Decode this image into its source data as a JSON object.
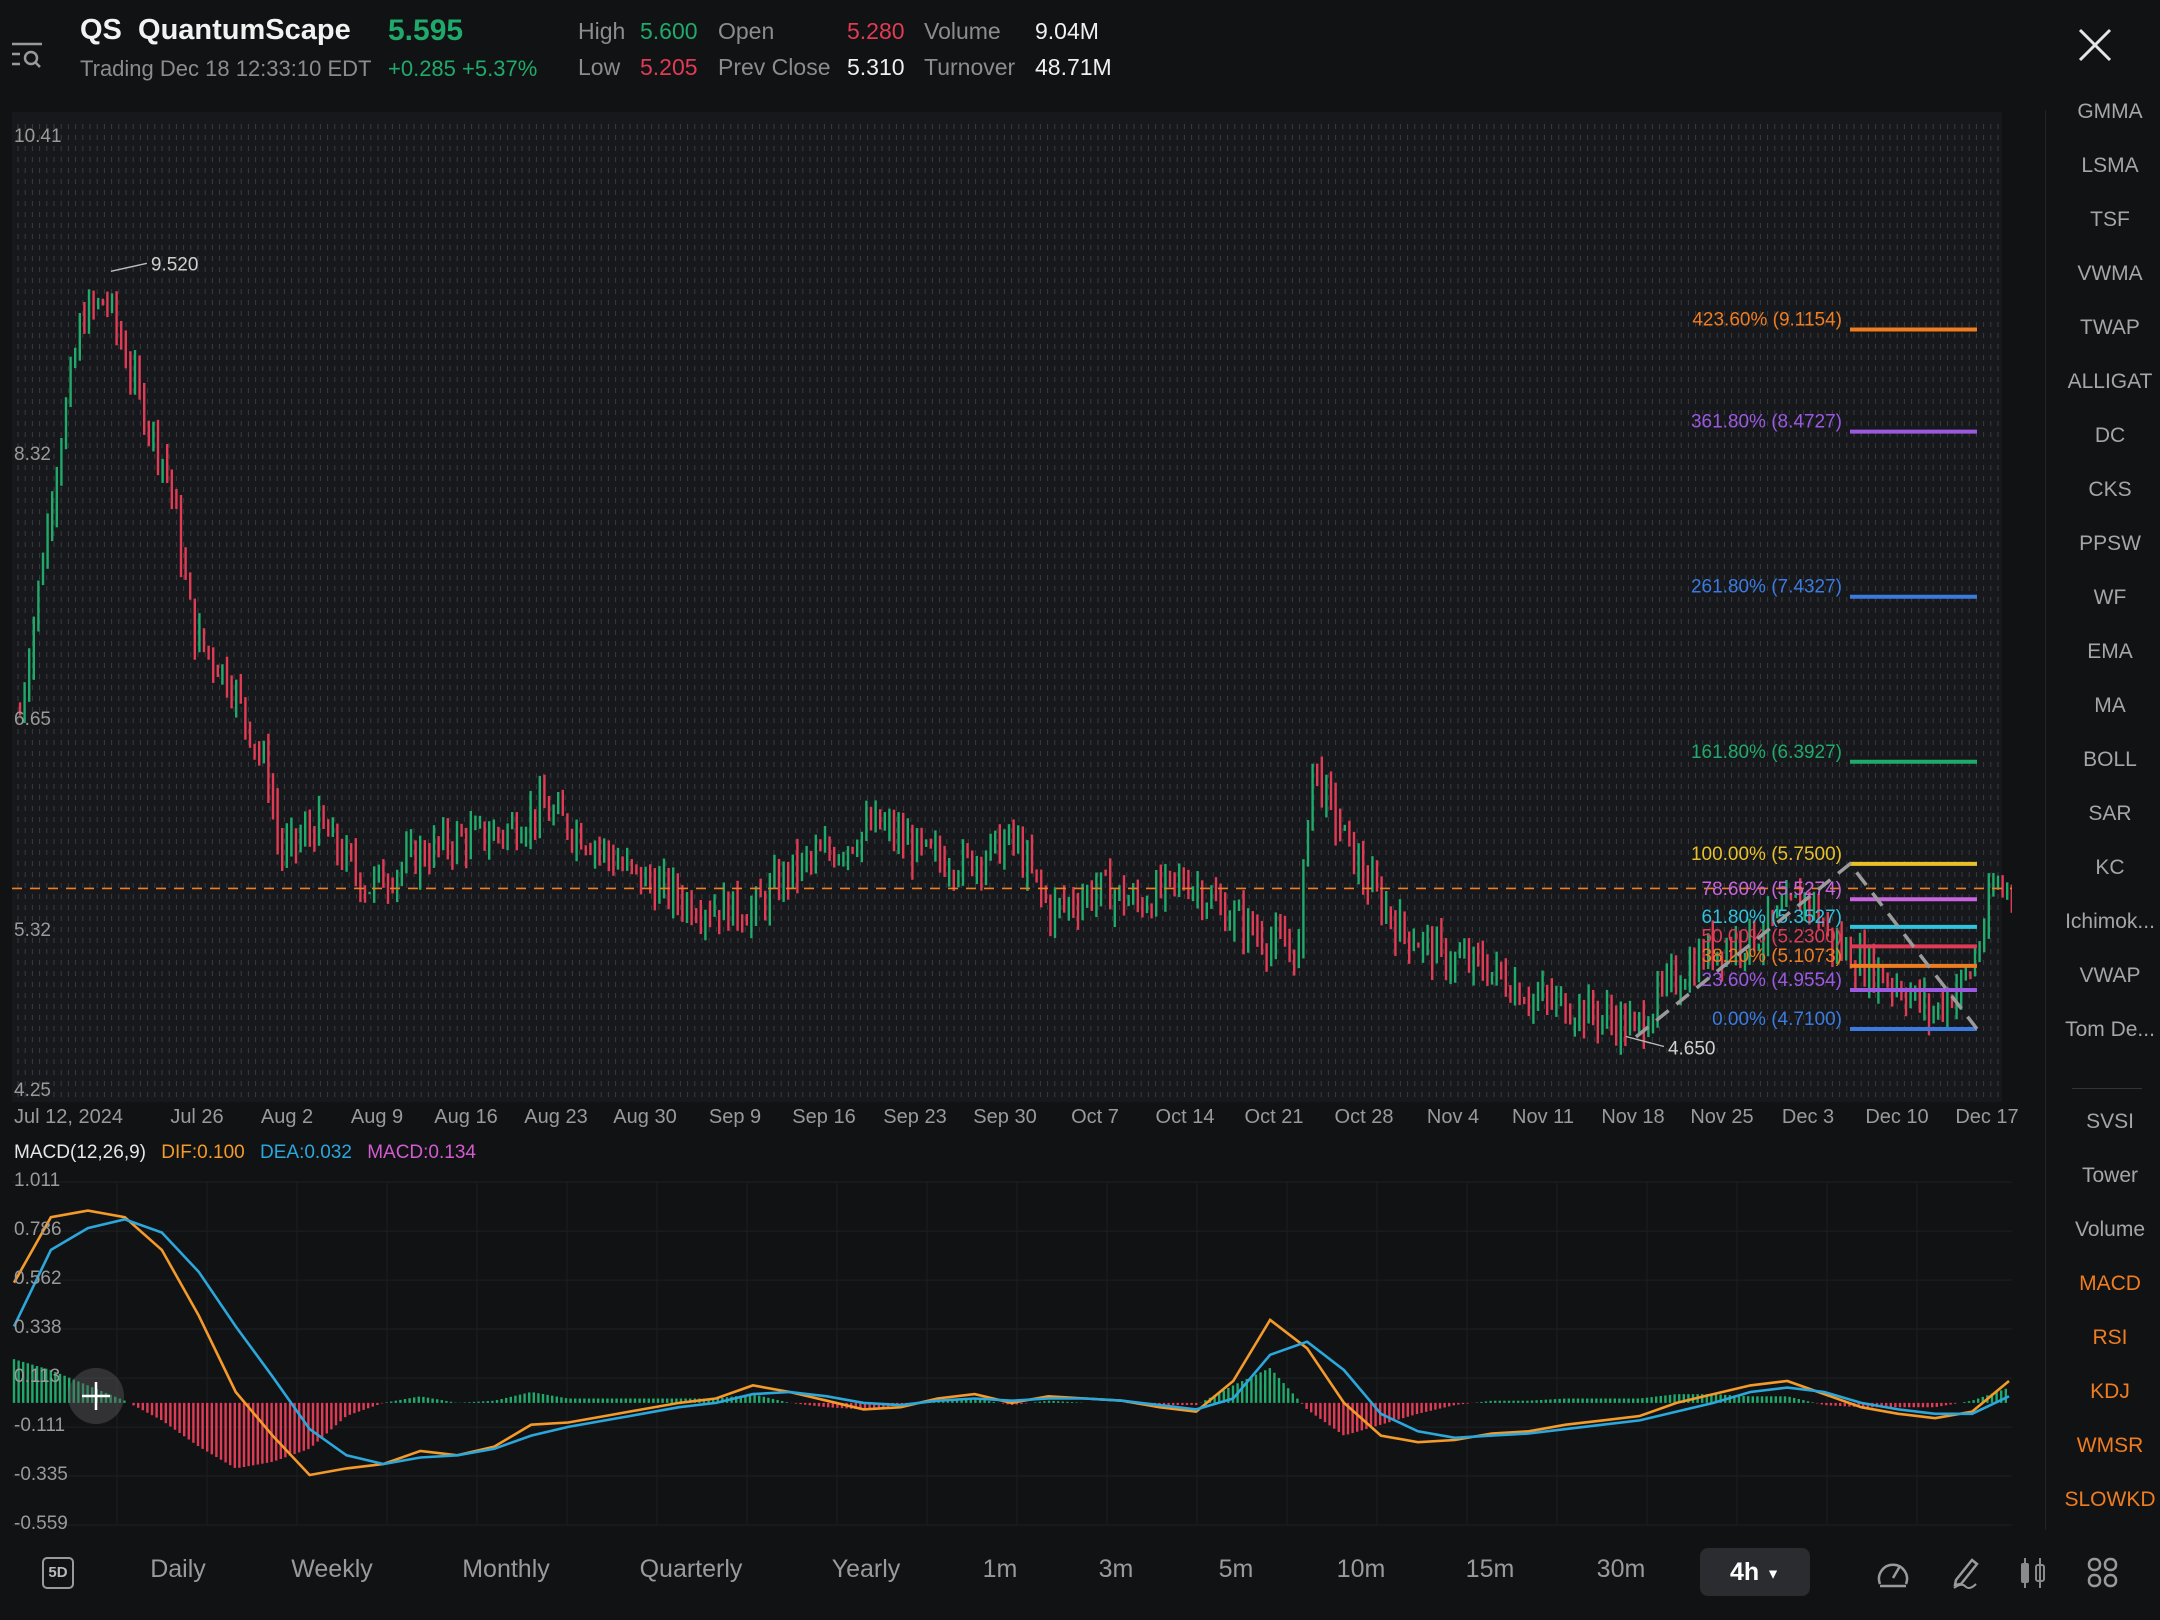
{
  "header": {
    "symbol": "QS",
    "name": "QuantumScape",
    "price": "5.595",
    "status": "Trading Dec 18 12:33:10 EDT",
    "change": "+0.285",
    "change_pct": "+5.37%",
    "stats": {
      "high_label": "High",
      "high": "5.600",
      "low_label": "Low",
      "low": "5.205",
      "open_label": "Open",
      "open": "5.280",
      "prev_close_label": "Prev Close",
      "prev_close": "5.310",
      "volume_label": "Volume",
      "volume": "9.04M",
      "turnover_label": "Turnover",
      "turnover": "48.71M"
    }
  },
  "colors": {
    "up": "#1faa6b",
    "down": "#e03b55",
    "accent": "#ee7d22",
    "dif": "#f39a2a",
    "dea": "#2ba7db",
    "macd": "#d35bd0"
  },
  "indicators": {
    "main": [
      "GMMA",
      "LSMA",
      "TSF",
      "VWMA",
      "TWAP",
      "ALLIGAT",
      "DC",
      "CKS",
      "PPSW",
      "WF",
      "EMA",
      "MA",
      "BOLL",
      "SAR",
      "KC",
      "Ichimok...",
      "VWAP",
      "Tom De..."
    ],
    "sub": [
      {
        "label": "SVSI",
        "active": false
      },
      {
        "label": "Tower",
        "active": false
      },
      {
        "label": "Volume",
        "active": false
      },
      {
        "label": "MACD",
        "active": true
      },
      {
        "label": "RSI",
        "active": true
      },
      {
        "label": "KDJ",
        "active": true
      },
      {
        "label": "WMSR",
        "active": true
      },
      {
        "label": "SLOWKD",
        "active": true
      }
    ]
  },
  "toolbar": {
    "five_day": "5D",
    "periods": [
      "Daily",
      "Weekly",
      "Monthly",
      "Quarterly",
      "Yearly",
      "1m",
      "3m",
      "5m",
      "10m",
      "15m",
      "30m"
    ],
    "active_period": "4h",
    "icons": [
      "speedometer-icon",
      "pencil-draw-icon",
      "candlestick-icon",
      "grid-menu-icon"
    ]
  },
  "chart_data": [
    {
      "type": "candlestick",
      "title": "QS QuantumScape 4h",
      "y_ticks": [
        "10.41",
        "8.32",
        "6.65",
        "5.32",
        "4.25"
      ],
      "ylim": [
        4.25,
        10.41
      ],
      "x_ticks": [
        "Jul 12, 2024",
        "Jul 26",
        "Aug 2",
        "Aug 9",
        "Aug 16",
        "Aug 23",
        "Aug 30",
        "Sep 9",
        "Sep 16",
        "Sep 23",
        "Sep 30",
        "Oct 7",
        "Oct 14",
        "Oct 21",
        "Oct 28",
        "Nov 4",
        "Nov 11",
        "Nov 18",
        "Nov 25",
        "Dec 3",
        "Dec 10",
        "Dec 17"
      ],
      "current_price_line": 5.595,
      "annotations": [
        {
          "label": "9.520",
          "type": "high",
          "date": "Jul 19"
        },
        {
          "label": "4.650",
          "type": "low",
          "date": "Nov 19"
        }
      ],
      "price_path": [
        {
          "x": "Jul 12",
          "v": 6.7
        },
        {
          "x": "Jul 15",
          "v": 8.3
        },
        {
          "x": "Jul 17",
          "v": 9.2
        },
        {
          "x": "Jul 19",
          "v": 9.3
        },
        {
          "x": "Jul 22",
          "v": 8.6
        },
        {
          "x": "Jul 24",
          "v": 8.2
        },
        {
          "x": "Jul 26",
          "v": 7.2
        },
        {
          "x": "Jul 29",
          "v": 6.9
        },
        {
          "x": "Aug 1",
          "v": 6.3
        },
        {
          "x": "Aug 2",
          "v": 5.8
        },
        {
          "x": "Aug 5",
          "v": 6.0
        },
        {
          "x": "Aug 7",
          "v": 5.8
        },
        {
          "x": "Aug 9",
          "v": 5.6
        },
        {
          "x": "Aug 13",
          "v": 5.8
        },
        {
          "x": "Aug 16",
          "v": 5.9
        },
        {
          "x": "Aug 20",
          "v": 5.95
        },
        {
          "x": "Aug 23",
          "v": 6.1
        },
        {
          "x": "Aug 27",
          "v": 5.9
        },
        {
          "x": "Aug 30",
          "v": 5.7
        },
        {
          "x": "Sep 4",
          "v": 5.5
        },
        {
          "x": "Sep 9",
          "v": 5.45
        },
        {
          "x": "Sep 12",
          "v": 5.7
        },
        {
          "x": "Sep 16",
          "v": 5.85
        },
        {
          "x": "Sep 19",
          "v": 6.0
        },
        {
          "x": "Sep 23",
          "v": 5.8
        },
        {
          "x": "Sep 26",
          "v": 5.75
        },
        {
          "x": "Sep 30",
          "v": 5.9
        },
        {
          "x": "Oct 3",
          "v": 5.45
        },
        {
          "x": "Oct 7",
          "v": 5.6
        },
        {
          "x": "Oct 10",
          "v": 5.5
        },
        {
          "x": "Oct 14",
          "v": 5.65
        },
        {
          "x": "Oct 17",
          "v": 5.45
        },
        {
          "x": "Oct 21",
          "v": 5.25
        },
        {
          "x": "Oct 23",
          "v": 5.2
        },
        {
          "x": "Oct 24",
          "v": 6.4
        },
        {
          "x": "Oct 25",
          "v": 6.2
        },
        {
          "x": "Oct 28",
          "v": 5.7
        },
        {
          "x": "Oct 31",
          "v": 5.35
        },
        {
          "x": "Nov 4",
          "v": 5.15
        },
        {
          "x": "Nov 7",
          "v": 5.1
        },
        {
          "x": "Nov 11",
          "v": 4.9
        },
        {
          "x": "Nov 14",
          "v": 4.85
        },
        {
          "x": "Nov 18",
          "v": 4.75
        },
        {
          "x": "Nov 19",
          "v": 4.7
        },
        {
          "x": "Nov 22",
          "v": 5.0
        },
        {
          "x": "Nov 25",
          "v": 5.2
        },
        {
          "x": "Nov 29",
          "v": 5.3
        },
        {
          "x": "Dec 3",
          "v": 5.55
        },
        {
          "x": "Dec 5",
          "v": 5.25
        },
        {
          "x": "Dec 9",
          "v": 5.05
        },
        {
          "x": "Dec 11",
          "v": 4.95
        },
        {
          "x": "Dec 13",
          "v": 4.8
        },
        {
          "x": "Dec 16",
          "v": 5.05
        },
        {
          "x": "Dec 17",
          "v": 5.3
        },
        {
          "x": "Dec 18",
          "v": 5.595
        }
      ],
      "fibonacci": [
        {
          "label": "423.60% (9.1154)",
          "value": 9.1154,
          "color": "#ee7d22"
        },
        {
          "label": "361.80% (8.4727)",
          "value": 8.4727,
          "color": "#9b59e0"
        },
        {
          "label": "261.80% (7.4327)",
          "value": 7.4327,
          "color": "#3b7be0"
        },
        {
          "label": "161.80% (6.3927)",
          "value": 6.3927,
          "color": "#1faa6b"
        },
        {
          "label": "100.00% (5.7500)",
          "value": 5.75,
          "color": "#e8c12a"
        },
        {
          "label": "78.60% (5.5274)",
          "value": 5.5274,
          "color": "#c864e0"
        },
        {
          "label": "61.80% (5.3527)",
          "value": 5.3527,
          "color": "#2ec4e0"
        },
        {
          "label": "50.00% (5.2300)",
          "value": 5.23,
          "color": "#e03b55"
        },
        {
          "label": "38.20% (5.1073)",
          "value": 5.1073,
          "color": "#ee7d22"
        },
        {
          "label": "23.60% (4.9554)",
          "value": 4.9554,
          "color": "#9b59e0"
        },
        {
          "label": "0.00% (4.7100)",
          "value": 4.71,
          "color": "#3b7be0"
        }
      ]
    },
    {
      "type": "line",
      "title": "MACD(12,26,9)",
      "legend": [
        {
          "label": "MACD(12,26,9)",
          "color": "#e6e6e6"
        },
        {
          "label": "DIF:0.100",
          "color": "#f39a2a"
        },
        {
          "label": "DEA:0.032",
          "color": "#2ba7db"
        },
        {
          "label": "MACD:0.134",
          "color": "#d35bd0"
        }
      ],
      "y_ticks": [
        "1.011",
        "0.786",
        "0.562",
        "0.338",
        "0.113",
        "-0.111",
        "-0.335",
        "-0.559"
      ],
      "ylim": [
        -0.559,
        1.011
      ],
      "dif": [
        0.55,
        0.85,
        0.88,
        0.85,
        0.7,
        0.4,
        0.05,
        -0.15,
        -0.33,
        -0.3,
        -0.28,
        -0.22,
        -0.24,
        -0.2,
        -0.1,
        -0.09,
        -0.06,
        -0.03,
        0.0,
        0.02,
        0.08,
        0.05,
        0.01,
        -0.03,
        -0.02,
        0.02,
        0.04,
        0.0,
        0.03,
        0.02,
        0.01,
        -0.02,
        -0.04,
        0.1,
        0.38,
        0.25,
        0.0,
        -0.15,
        -0.18,
        -0.17,
        -0.14,
        -0.13,
        -0.1,
        -0.08,
        -0.06,
        0.0,
        0.04,
        0.08,
        0.1,
        0.04,
        -0.02,
        -0.05,
        -0.07,
        -0.04,
        0.1
      ],
      "dea": [
        0.35,
        0.7,
        0.8,
        0.84,
        0.78,
        0.6,
        0.35,
        0.12,
        -0.12,
        -0.24,
        -0.28,
        -0.25,
        -0.24,
        -0.21,
        -0.15,
        -0.11,
        -0.08,
        -0.05,
        -0.02,
        0.0,
        0.04,
        0.05,
        0.03,
        0.0,
        -0.01,
        0.01,
        0.02,
        0.01,
        0.02,
        0.02,
        0.01,
        -0.01,
        -0.03,
        0.02,
        0.22,
        0.28,
        0.15,
        -0.05,
        -0.13,
        -0.16,
        -0.15,
        -0.14,
        -0.12,
        -0.1,
        -0.08,
        -0.04,
        0.0,
        0.05,
        0.07,
        0.05,
        0.0,
        -0.03,
        -0.05,
        -0.05,
        0.03
      ]
    }
  ]
}
